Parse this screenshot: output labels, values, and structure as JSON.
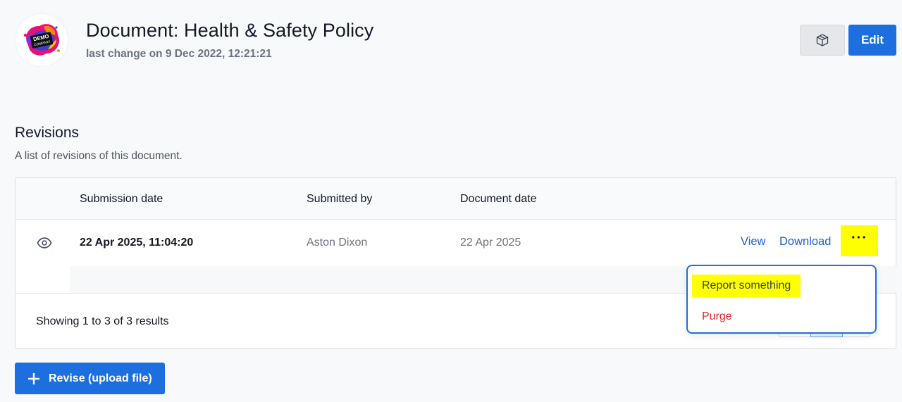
{
  "header": {
    "title": "Document: Health & Safety Policy",
    "subtitle": "last change on 9 Dec 2022, 12:21:21",
    "logo_text_line1": "DEMO",
    "logo_text_line2": "COMPANY",
    "cube_icon": "cube-icon",
    "edit_label": "Edit"
  },
  "revisions": {
    "title": "Revisions",
    "description": "A list of revisions of this document.",
    "columns": [
      "Submission date",
      "Submitted by",
      "Document date"
    ],
    "rows": [
      {
        "submission_date": "22 Apr 2025, 11:04:20",
        "submitted_by": "Aston Dixon",
        "document_date": "22 Apr 2025",
        "view_label": "View",
        "download_label": "Download",
        "more_label": "···"
      }
    ],
    "footer_text": "Showing 1 to 3 of 3 results"
  },
  "dropdown": {
    "items": [
      {
        "label": "Report something",
        "color": "#374151"
      },
      {
        "label": "Purge",
        "color": "#dc2626"
      }
    ]
  },
  "actions": {
    "revise_label": "Revise (upload file)"
  },
  "colors": {
    "primary": "#1d6fe0",
    "highlight": "#ffff00",
    "danger": "#dc2626"
  }
}
